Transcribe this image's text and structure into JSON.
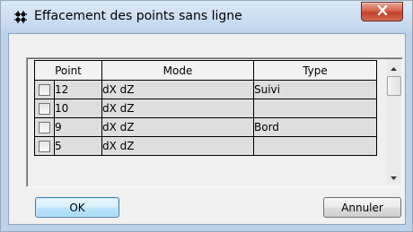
{
  "window": {
    "title": "Effacement des points sans ligne"
  },
  "table": {
    "columns": {
      "point": "Point",
      "mode": "Mode",
      "type": "Type"
    },
    "rows": [
      {
        "checked": false,
        "point": "12",
        "mode": "dX dZ",
        "type": "Suivi"
      },
      {
        "checked": false,
        "point": "10",
        "mode": "dX dZ",
        "type": ""
      },
      {
        "checked": false,
        "point": "9",
        "mode": "dX dZ",
        "type": "Bord"
      },
      {
        "checked": false,
        "point": "5",
        "mode": "dX dZ",
        "type": ""
      }
    ]
  },
  "buttons": {
    "ok": "OK",
    "cancel": "Annuler"
  },
  "icons": {
    "app": "grid-points-icon",
    "close": "close-icon",
    "scroll_up": "arrow-up-icon",
    "scroll_down": "arrow-down-icon"
  }
}
